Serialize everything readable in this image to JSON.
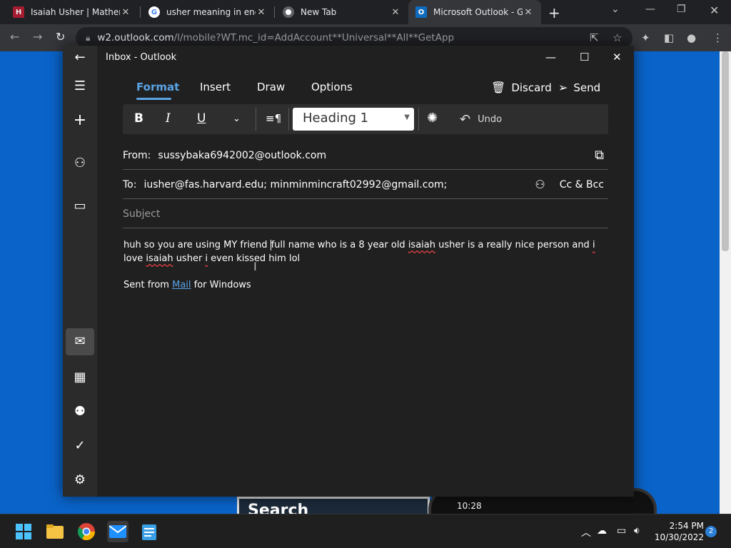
{
  "browser": {
    "tabs": [
      {
        "title": "Isaiah Usher | Mather H",
        "favicon": "harvard-icon",
        "color": "#a51c30"
      },
      {
        "title": "usher meaning in engli",
        "favicon": "google-icon",
        "color": "#4285f4"
      },
      {
        "title": "New Tab",
        "favicon": "chrome-icon",
        "color": "#ffffff"
      },
      {
        "title": "Microsoft Outlook - Ge",
        "favicon": "outlook-icon",
        "color": "#0f6cbd"
      }
    ],
    "url_host": "w2.outlook.com",
    "url_path": "/l/mobile?WT.mc_id=AddAccount**Universal**All**GetApp"
  },
  "mail": {
    "window_title": "Inbox - Outlook",
    "tabs": [
      "Format",
      "Insert",
      "Draw",
      "Options"
    ],
    "active_tab": "Format",
    "discard_label": "Discard",
    "send_label": "Send",
    "ribbon": {
      "bold": "B",
      "italic": "I",
      "underline": "U",
      "style": "Heading 1",
      "undo": "Undo"
    },
    "from_label": "From:",
    "from_value": "sussybaka6942002@outlook.com",
    "to_label": "To:",
    "to_value": "iusher@fas.harvard.edu; minminmincraft02992@gmail.com;",
    "ccbcc_label": "Cc & Bcc",
    "subject_placeholder": "Subject",
    "body": {
      "p1": "huh so you are using MY friend ",
      "p2": "full name who is a 8 year old ",
      "w1": "isaiah",
      "p3": " usher is a really nice person and ",
      "w2": "i",
      "p4": " love ",
      "w3": "isaiah",
      "p5": " usher ",
      "w4": "i",
      "p6": " even kissed him lol"
    },
    "sig_before": "Sent from ",
    "sig_link": "Mail",
    "sig_after": " for Windows"
  },
  "background_page": {
    "search_text": "Search",
    "phone_time": "10:28"
  },
  "taskbar": {
    "time": "2:54 PM",
    "date": "10/30/2022",
    "notifications": "2"
  },
  "colors": {
    "accent": "#5aa4e6",
    "page_blue": "#0a63c9",
    "mail_bg": "#202020"
  }
}
